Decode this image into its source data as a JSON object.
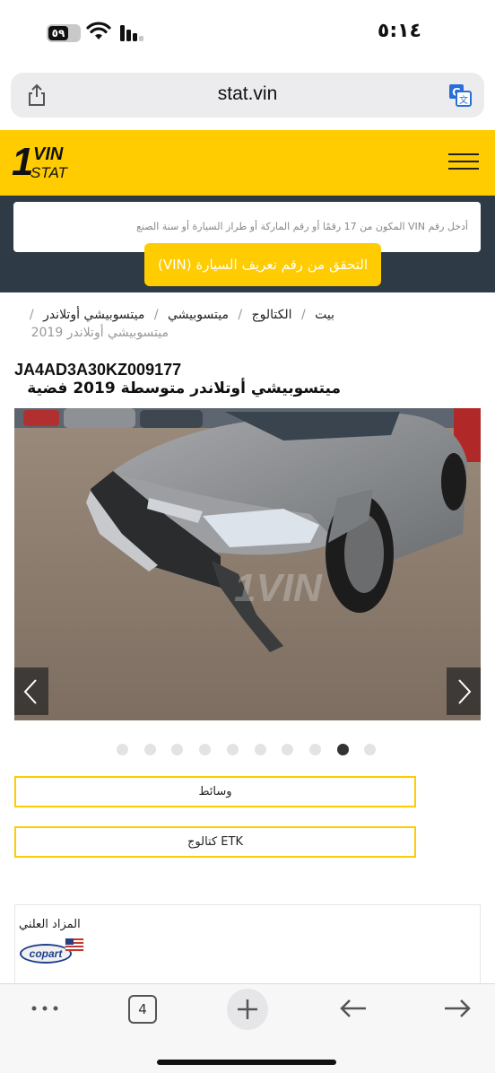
{
  "status_bar": {
    "time": "٥:١٤",
    "battery": "٥٩"
  },
  "browser": {
    "url": "stat.vin",
    "tab_count": "4"
  },
  "site": {
    "logo_number": "1",
    "logo_top": "VIN",
    "logo_bottom": "STAT"
  },
  "search": {
    "placeholder": "أدخل رقم VIN المكون من 17 رقمًا أو رقم الماركة أو طراز السيارة أو سنة الصنع",
    "button_label": "التحقق من رقم تعريف السيارة (VIN)"
  },
  "breadcrumb": {
    "home": "بيت",
    "catalog": "الكتالوج",
    "make": "ميتسوبيشي",
    "model": "ميتسوبيشي أوتلاندر",
    "current": "ميتسوبيشي أوتلاندر 2019"
  },
  "vehicle": {
    "vin": "JA4AD3A30KZ009177",
    "title": "ميتسوبيشي أوتلاندر متوسطة 2019 فضية"
  },
  "gallery": {
    "total_slides": 10,
    "active_slide": 9
  },
  "buttons": {
    "media": "وسائط",
    "etk_catalog": "كتالوج ETK"
  },
  "auction": {
    "label": "المزاد العلني",
    "brand": "copart"
  },
  "colors": {
    "accent": "#fecc00",
    "dark_band": "#2e3a45"
  }
}
